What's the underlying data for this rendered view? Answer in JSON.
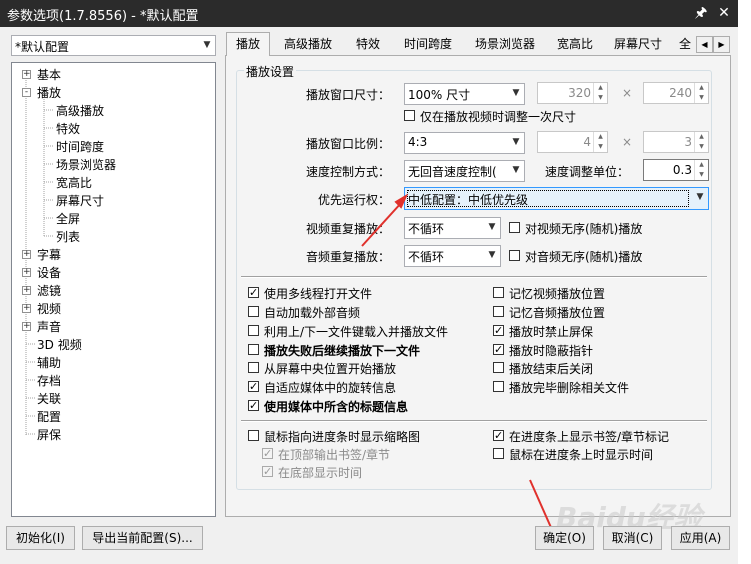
{
  "window": {
    "title": "参数选项(1.7.8556) - *默认配置",
    "pin_icon": "pin-icon",
    "close_icon": "close-icon"
  },
  "profile": {
    "selected": "*默认配置"
  },
  "tree": {
    "items": [
      {
        "label": "基本",
        "level": 0,
        "expander": "+"
      },
      {
        "label": "播放",
        "level": 0,
        "expander": "-"
      },
      {
        "label": "高级播放",
        "level": 1
      },
      {
        "label": "特效",
        "level": 1
      },
      {
        "label": "时间跨度",
        "level": 1
      },
      {
        "label": "场景浏览器",
        "level": 1
      },
      {
        "label": "宽高比",
        "level": 1
      },
      {
        "label": "屏幕尺寸",
        "level": 1
      },
      {
        "label": "全屏",
        "level": 1
      },
      {
        "label": "列表",
        "level": 1
      },
      {
        "label": "字幕",
        "level": 0,
        "expander": "+"
      },
      {
        "label": "设备",
        "level": 0,
        "expander": "+"
      },
      {
        "label": "滤镜",
        "level": 0,
        "expander": "+"
      },
      {
        "label": "视频",
        "level": 0,
        "expander": "+"
      },
      {
        "label": "声音",
        "level": 0,
        "expander": "+"
      },
      {
        "label": "3D 视频",
        "level": 0
      },
      {
        "label": "辅助",
        "level": 0
      },
      {
        "label": "存档",
        "level": 0
      },
      {
        "label": "关联",
        "level": 0
      },
      {
        "label": "配置",
        "level": 0
      },
      {
        "label": "屏保",
        "level": 0
      }
    ]
  },
  "tabs": [
    "播放",
    "高级播放",
    "特效",
    "时间跨度",
    "场景浏览器",
    "宽高比",
    "屏幕尺寸",
    "全"
  ],
  "group": {
    "title": "播放设置"
  },
  "form": {
    "window_size_label": "播放窗口尺寸：",
    "window_size_value": "100% 尺寸",
    "width": "320",
    "height": "240",
    "times": "×",
    "adjust_once": "仅在播放视频时调整一次尺寸",
    "ratio_label": "播放窗口比例：",
    "ratio_value": "4:3",
    "ratio_a": "4",
    "ratio_b": "3",
    "speed_mode_label": "速度控制方式：",
    "speed_mode_value": "无回音速度控制(",
    "speed_unit_label": "速度调整单位：",
    "speed_unit_value": "0.3",
    "priority_label": "优先运行权：",
    "priority_value": "中低配置：中低优先级",
    "video_repeat_label": "视频重复播放：",
    "video_repeat_value": "不循环",
    "video_random": "对视频无序(随机)播放",
    "audio_repeat_label": "音频重复播放：",
    "audio_repeat_value": "不循环",
    "audio_random": "对音频无序(随机)播放"
  },
  "options_left": [
    {
      "label": "使用多线程打开文件",
      "checked": true,
      "bold": false
    },
    {
      "label": "自动加载外部音频",
      "checked": false,
      "bold": false
    },
    {
      "label": "利用上/下一文件键载入并播放文件",
      "checked": false,
      "bold": false
    },
    {
      "label": "播放失败后继续播放下一文件",
      "checked": false,
      "bold": true
    },
    {
      "label": "从屏幕中央位置开始播放",
      "checked": false,
      "bold": false
    },
    {
      "label": "自适应媒体中的旋转信息",
      "checked": true,
      "bold": false
    },
    {
      "label": "使用媒体中所含的标题信息",
      "checked": true,
      "bold": true
    }
  ],
  "options_right": [
    {
      "label": "记忆视频播放位置",
      "checked": false
    },
    {
      "label": "记忆音频播放位置",
      "checked": false
    },
    {
      "label": "播放时禁止屏保",
      "checked": true
    },
    {
      "label": "播放时隐蔽指针",
      "checked": true
    },
    {
      "label": "播放结束后关闭",
      "checked": false
    },
    {
      "label": "播放完毕删除相关文件",
      "checked": false
    }
  ],
  "options_bottom": {
    "thumb": "鼠标指向进度条时显示缩略图",
    "top_bookmark": "在顶部输出书签/章节",
    "bottom_time": "在底部显示时间",
    "progress_marks": "在进度条上显示书签/章节标记",
    "hover_time": "鼠标在进度条上时显示时间"
  },
  "buttons": {
    "init": "初始化(I)",
    "export": "导出当前配置(S)...",
    "ok": "确定(O)",
    "cancel": "取消(C)",
    "apply": "应用(A)"
  },
  "watermark": "Baidu经验",
  "colors": {
    "arrow": "#e0312c",
    "titlebar": "#2b2b2b",
    "highlight_border": "#3399ff"
  }
}
